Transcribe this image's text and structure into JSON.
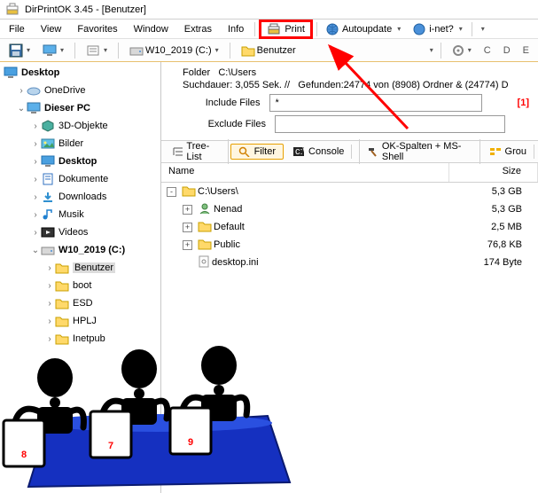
{
  "title": "DirPrintOK 3.45 - [Benutzer]",
  "menu": {
    "file": "File",
    "view": "View",
    "favorites": "Favorites",
    "window": "Window",
    "extras": "Extras",
    "info": "Info",
    "print": "Print",
    "autoupdate": "Autoupdate",
    "inet": "i-net?"
  },
  "toolbar": {
    "drive_label": "W10_2019 (C:)",
    "folder_label": "Benutzer",
    "drives": [
      "C",
      "D",
      "E"
    ]
  },
  "tree": {
    "root": "Desktop",
    "items": [
      {
        "label": "OneDrive",
        "icon": "cloud"
      },
      {
        "label": "Dieser PC",
        "icon": "pc",
        "expanded": true
      },
      {
        "label": "3D-Objekte",
        "icon": "3d",
        "level": 2
      },
      {
        "label": "Bilder",
        "icon": "pictures",
        "level": 2
      },
      {
        "label": "Desktop",
        "icon": "desktop",
        "level": 2
      },
      {
        "label": "Dokumente",
        "icon": "docs",
        "level": 2
      },
      {
        "label": "Downloads",
        "icon": "downloads",
        "level": 2
      },
      {
        "label": "Musik",
        "icon": "music",
        "level": 2
      },
      {
        "label": "Videos",
        "icon": "videos",
        "level": 2
      },
      {
        "label": "W10_2019 (C:)",
        "icon": "disk",
        "level": 2,
        "expanded": true
      },
      {
        "label": "Benutzer",
        "icon": "folder",
        "level": 3,
        "selected": true
      },
      {
        "label": "boot",
        "icon": "folder",
        "level": 3
      },
      {
        "label": "ESD",
        "icon": "folder",
        "level": 3
      },
      {
        "label": "HPLJ",
        "icon": "folder",
        "level": 3
      },
      {
        "label": "Inetpub",
        "icon": "folder",
        "level": 3
      }
    ]
  },
  "info": {
    "folder_label": "Folder",
    "folder_path": "C:\\Users",
    "stats_a": "Suchdauer: 3,055 Sek. //",
    "stats_b": "Gefunden:24774 von (8908) Ordner & (24774) D",
    "include_label": "Include Files",
    "include_value": "*",
    "exclude_label": "Exclude Files",
    "exclude_value": "",
    "annotation": "[1]"
  },
  "tabs": {
    "treelist": "Tree-List",
    "filter": "Filter",
    "console": "Console",
    "okspalten": "OK-Spalten + MS-Shell",
    "group": "Grou"
  },
  "list": {
    "cols": {
      "name": "Name",
      "size": "Size"
    },
    "rows": [
      {
        "name": "C:\\Users\\",
        "size": "5,3 GB",
        "icon": "folder",
        "exp": "-"
      },
      {
        "name": "Nenad",
        "size": "5,3 GB",
        "icon": "user",
        "exp": "+",
        "indent": 1
      },
      {
        "name": "Default",
        "size": "2,5 MB",
        "icon": "folder",
        "exp": "+",
        "indent": 1
      },
      {
        "name": "Public",
        "size": "76,8 KB",
        "icon": "folder",
        "exp": "+",
        "indent": 1
      },
      {
        "name": "desktop.ini",
        "size": "174 Byte",
        "icon": "ini",
        "indent": 1
      }
    ]
  },
  "cartoon": {
    "scores": [
      "8",
      "7",
      "9"
    ]
  }
}
